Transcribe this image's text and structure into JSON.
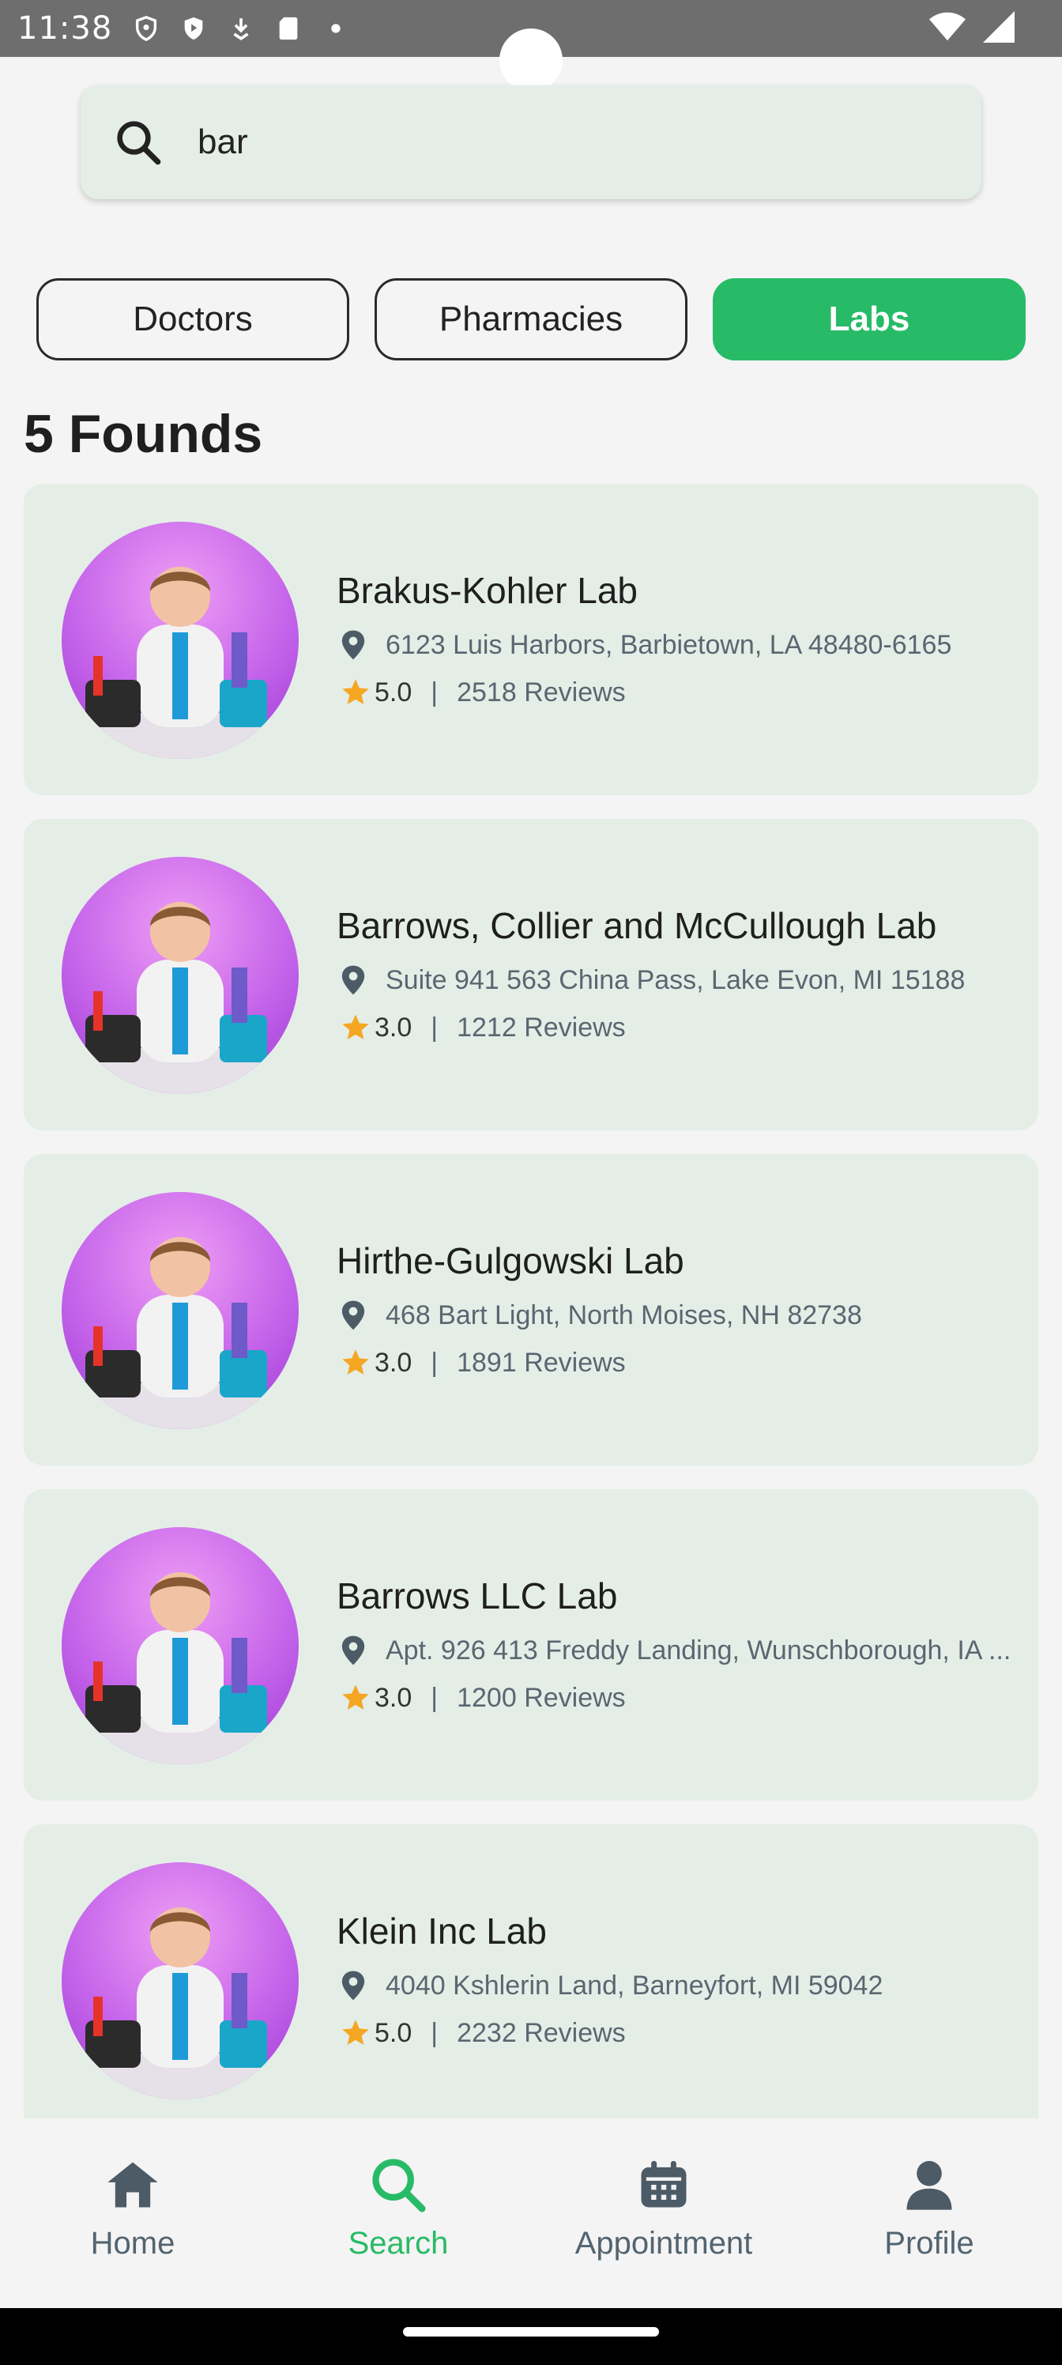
{
  "status_bar": {
    "time": "11:38"
  },
  "search": {
    "value": "bar",
    "icon": "search-icon"
  },
  "tabs": [
    {
      "label": "Doctors",
      "active": false
    },
    {
      "label": "Pharmacies",
      "active": false
    },
    {
      "label": "Labs",
      "active": true
    }
  ],
  "results_title": "5 Founds",
  "results": [
    {
      "name": "Brakus-Kohler Lab",
      "address": "6123 Luis Harbors, Barbietown, LA 48480-6165",
      "rating": "5.0",
      "reviews": "2518 Reviews"
    },
    {
      "name": "Barrows, Collier and McCullough Lab",
      "address": "Suite 941 563 China Pass, Lake Evon, MI 15188",
      "rating": "3.0",
      "reviews": "1212 Reviews"
    },
    {
      "name": "Hirthe-Gulgowski Lab",
      "address": "468 Bart Light, North Moises, NH 82738",
      "rating": "3.0",
      "reviews": "1891 Reviews"
    },
    {
      "name": "Barrows LLC Lab",
      "address": "Apt. 926 413 Freddy Landing, Wunschborough, IA ...",
      "rating": "3.0",
      "reviews": "1200 Reviews"
    },
    {
      "name": "Klein Inc Lab",
      "address": "4040 Kshlerin Land, Barneyfort, MI 59042",
      "rating": "5.0",
      "reviews": "2232 Reviews"
    }
  ],
  "rating_separator": "|",
  "bottom_nav": [
    {
      "label": "Home",
      "icon": "home-icon",
      "active": false
    },
    {
      "label": "Search",
      "icon": "search-icon",
      "active": true
    },
    {
      "label": "Appointment",
      "icon": "calendar-icon",
      "active": false
    },
    {
      "label": "Profile",
      "icon": "user-icon",
      "active": false
    }
  ],
  "colors": {
    "accent": "#28bb67",
    "card_bg": "#e4eee7",
    "star": "#f5a623",
    "muted_text": "#5a6670"
  }
}
